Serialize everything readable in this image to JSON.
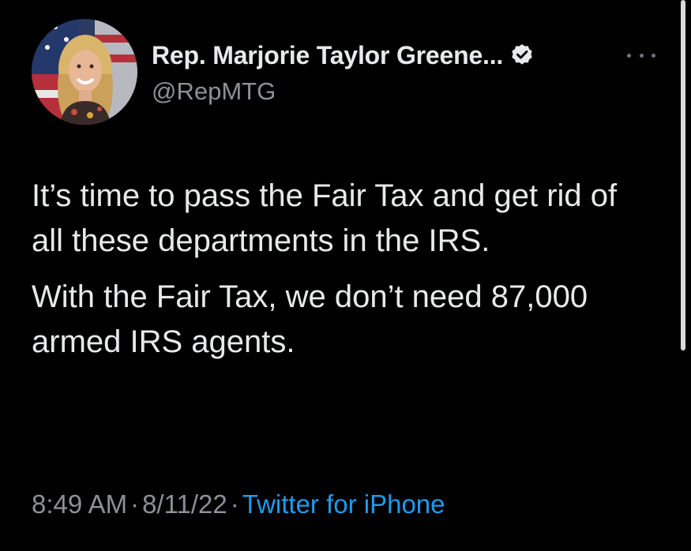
{
  "author": {
    "display_name": "Rep. Marjorie Taylor Greene...",
    "handle": "@RepMTG",
    "verified": true,
    "avatar_icon": "profile-photo"
  },
  "tweet": {
    "paragraphs": [
      "It’s time to pass the Fair Tax and get rid of all these departments in the IRS.",
      "With the Fair Tax, we don’t need 87,000 armed IRS agents."
    ]
  },
  "meta": {
    "time": "8:49 AM",
    "separator": "·",
    "date": "8/11/22",
    "source": "Twitter for iPhone"
  },
  "icons": {
    "more": "more-options-icon",
    "verified": "verified-badge-icon"
  },
  "colors": {
    "background": "#000000",
    "text": "#e7e9ea",
    "secondary": "#8b9196",
    "link": "#1d9bf0"
  }
}
